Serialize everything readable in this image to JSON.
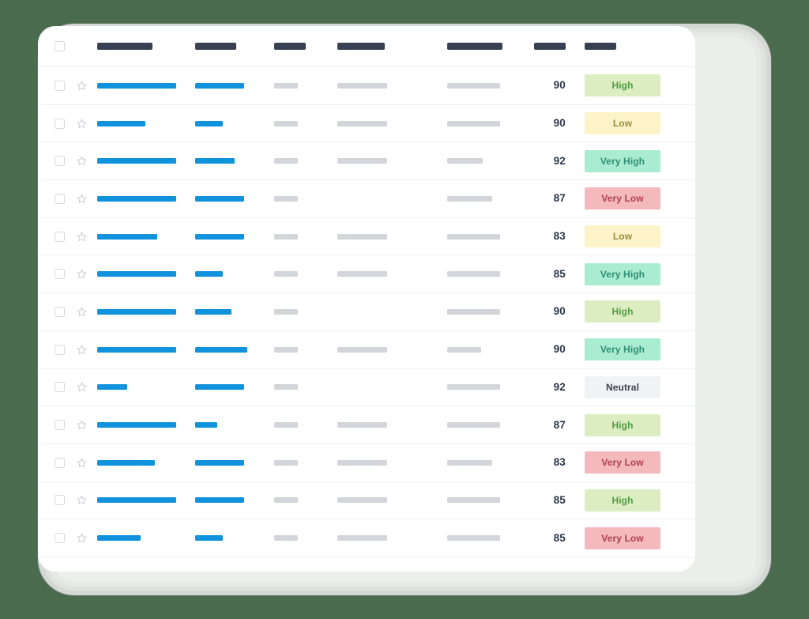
{
  "theme": {
    "background": "#4a6b4d",
    "card": "#ffffff",
    "bar_blue": "#1192dd",
    "bar_gray": "#d2d5d9",
    "bar_dark": "#374151",
    "score_color": "#2d3748",
    "row_divider": "#f0f1f3"
  },
  "table": {
    "header": {
      "select_all_checkbox": "unchecked",
      "columns": [
        {
          "name": "column-1",
          "placeholder_width": 70
        },
        {
          "name": "column-2",
          "placeholder_width": 52
        },
        {
          "name": "column-3",
          "placeholder_width": 40
        },
        {
          "name": "column-4",
          "placeholder_width": 60
        },
        {
          "name": "column-5",
          "placeholder_width": 70
        },
        {
          "name": "column-score",
          "placeholder_width": 40
        },
        {
          "name": "column-rating",
          "placeholder_width": 40
        }
      ]
    },
    "rows": [
      {
        "checkbox": "unchecked",
        "starred": false,
        "bar1": 100,
        "bar2": 78,
        "bar3": 53,
        "bar4": 79,
        "bar5": 82,
        "score": "90",
        "rating": "High",
        "rating_bg": "#dcedc2",
        "rating_fg": "#4f9a41"
      },
      {
        "checkbox": "unchecked",
        "starred": false,
        "bar1": 61,
        "bar2": 44,
        "bar3": 53,
        "bar4": 79,
        "bar5": 82,
        "score": "90",
        "rating": "Low",
        "rating_bg": "#fcf4c8",
        "rating_fg": "#9a8b3c"
      },
      {
        "checkbox": "unchecked",
        "starred": false,
        "bar1": 100,
        "bar2": 62,
        "bar3": 53,
        "bar4": 79,
        "bar5": 55,
        "score": "92",
        "rating": "Very High",
        "rating_bg": "#a9ecd2",
        "rating_fg": "#2f8f74"
      },
      {
        "checkbox": "unchecked",
        "starred": false,
        "bar1": 100,
        "bar2": 78,
        "bar3": 53,
        "bar4": 0,
        "bar5": 70,
        "score": "87",
        "rating": "Very Low",
        "rating_bg": "#f3b9bd",
        "rating_fg": "#b04050"
      },
      {
        "checkbox": "unchecked",
        "starred": false,
        "bar1": 76,
        "bar2": 78,
        "bar3": 53,
        "bar4": 79,
        "bar5": 82,
        "score": "83",
        "rating": "Low",
        "rating_bg": "#fcf4c8",
        "rating_fg": "#9a8b3c"
      },
      {
        "checkbox": "unchecked",
        "starred": false,
        "bar1": 100,
        "bar2": 44,
        "bar3": 53,
        "bar4": 79,
        "bar5": 82,
        "score": "85",
        "rating": "Very High",
        "rating_bg": "#a9ecd2",
        "rating_fg": "#2f8f74"
      },
      {
        "checkbox": "unchecked",
        "starred": false,
        "bar1": 100,
        "bar2": 58,
        "bar3": 53,
        "bar4": 0,
        "bar5": 82,
        "score": "90",
        "rating": "High",
        "rating_bg": "#dcedc2",
        "rating_fg": "#4f9a41"
      },
      {
        "checkbox": "unchecked",
        "starred": false,
        "bar1": 100,
        "bar2": 82,
        "bar3": 53,
        "bar4": 79,
        "bar5": 53,
        "score": "90",
        "rating": "Very High",
        "rating_bg": "#a9ecd2",
        "rating_fg": "#2f8f74"
      },
      {
        "checkbox": "unchecked",
        "starred": false,
        "bar1": 38,
        "bar2": 78,
        "bar3": 53,
        "bar4": 0,
        "bar5": 82,
        "score": "92",
        "rating": "Neutral",
        "rating_bg": "#f1f2f3",
        "rating_fg": "#3b4250"
      },
      {
        "checkbox": "unchecked",
        "starred": false,
        "bar1": 100,
        "bar2": 35,
        "bar3": 53,
        "bar4": 79,
        "bar5": 82,
        "score": "87",
        "rating": "High",
        "rating_bg": "#dcedc2",
        "rating_fg": "#4f9a41"
      },
      {
        "checkbox": "unchecked",
        "starred": false,
        "bar1": 73,
        "bar2": 78,
        "bar3": 53,
        "bar4": 79,
        "bar5": 70,
        "score": "83",
        "rating": "Very Low",
        "rating_bg": "#f3b9bd",
        "rating_fg": "#b04050"
      },
      {
        "checkbox": "unchecked",
        "starred": false,
        "bar1": 100,
        "bar2": 78,
        "bar3": 53,
        "bar4": 79,
        "bar5": 82,
        "score": "85",
        "rating": "High",
        "rating_bg": "#dcedc2",
        "rating_fg": "#4f9a41"
      },
      {
        "checkbox": "unchecked",
        "starred": false,
        "bar1": 55,
        "bar2": 44,
        "bar3": 53,
        "bar4": 79,
        "bar5": 82,
        "score": "85",
        "rating": "Very Low",
        "rating_bg": "#f3b9bd",
        "rating_fg": "#b04050"
      }
    ]
  }
}
